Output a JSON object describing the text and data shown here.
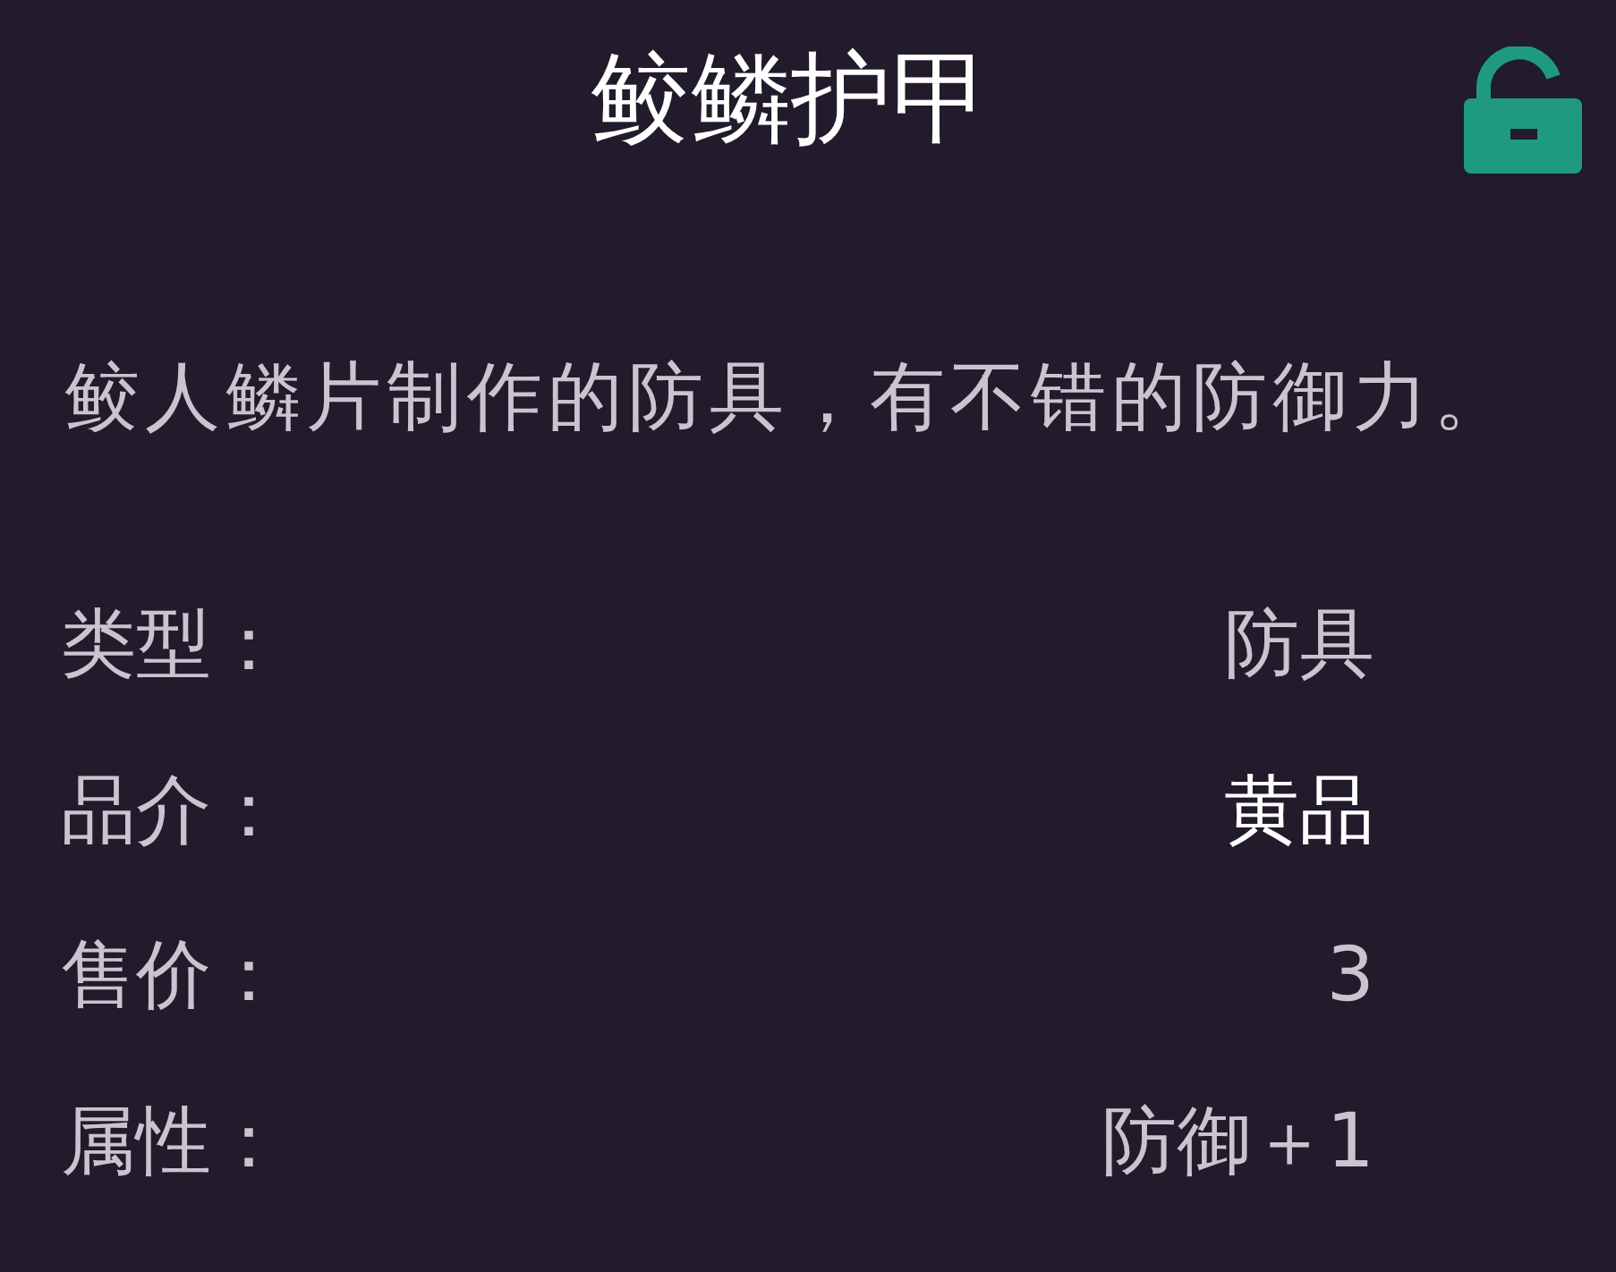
{
  "title": "鲛鳞护甲",
  "lock": {
    "locked": false
  },
  "description": "鲛人鳞片制作的防具，有不错的防御力。",
  "attributes": [
    {
      "label": "类型：",
      "value": "防具",
      "highlighted": false
    },
    {
      "label": "品介：",
      "value": "黄品",
      "highlighted": true
    },
    {
      "label": "售价：",
      "value": "3",
      "highlighted": false
    },
    {
      "label": "属性：",
      "value": "防御＋1",
      "highlighted": false
    }
  ]
}
